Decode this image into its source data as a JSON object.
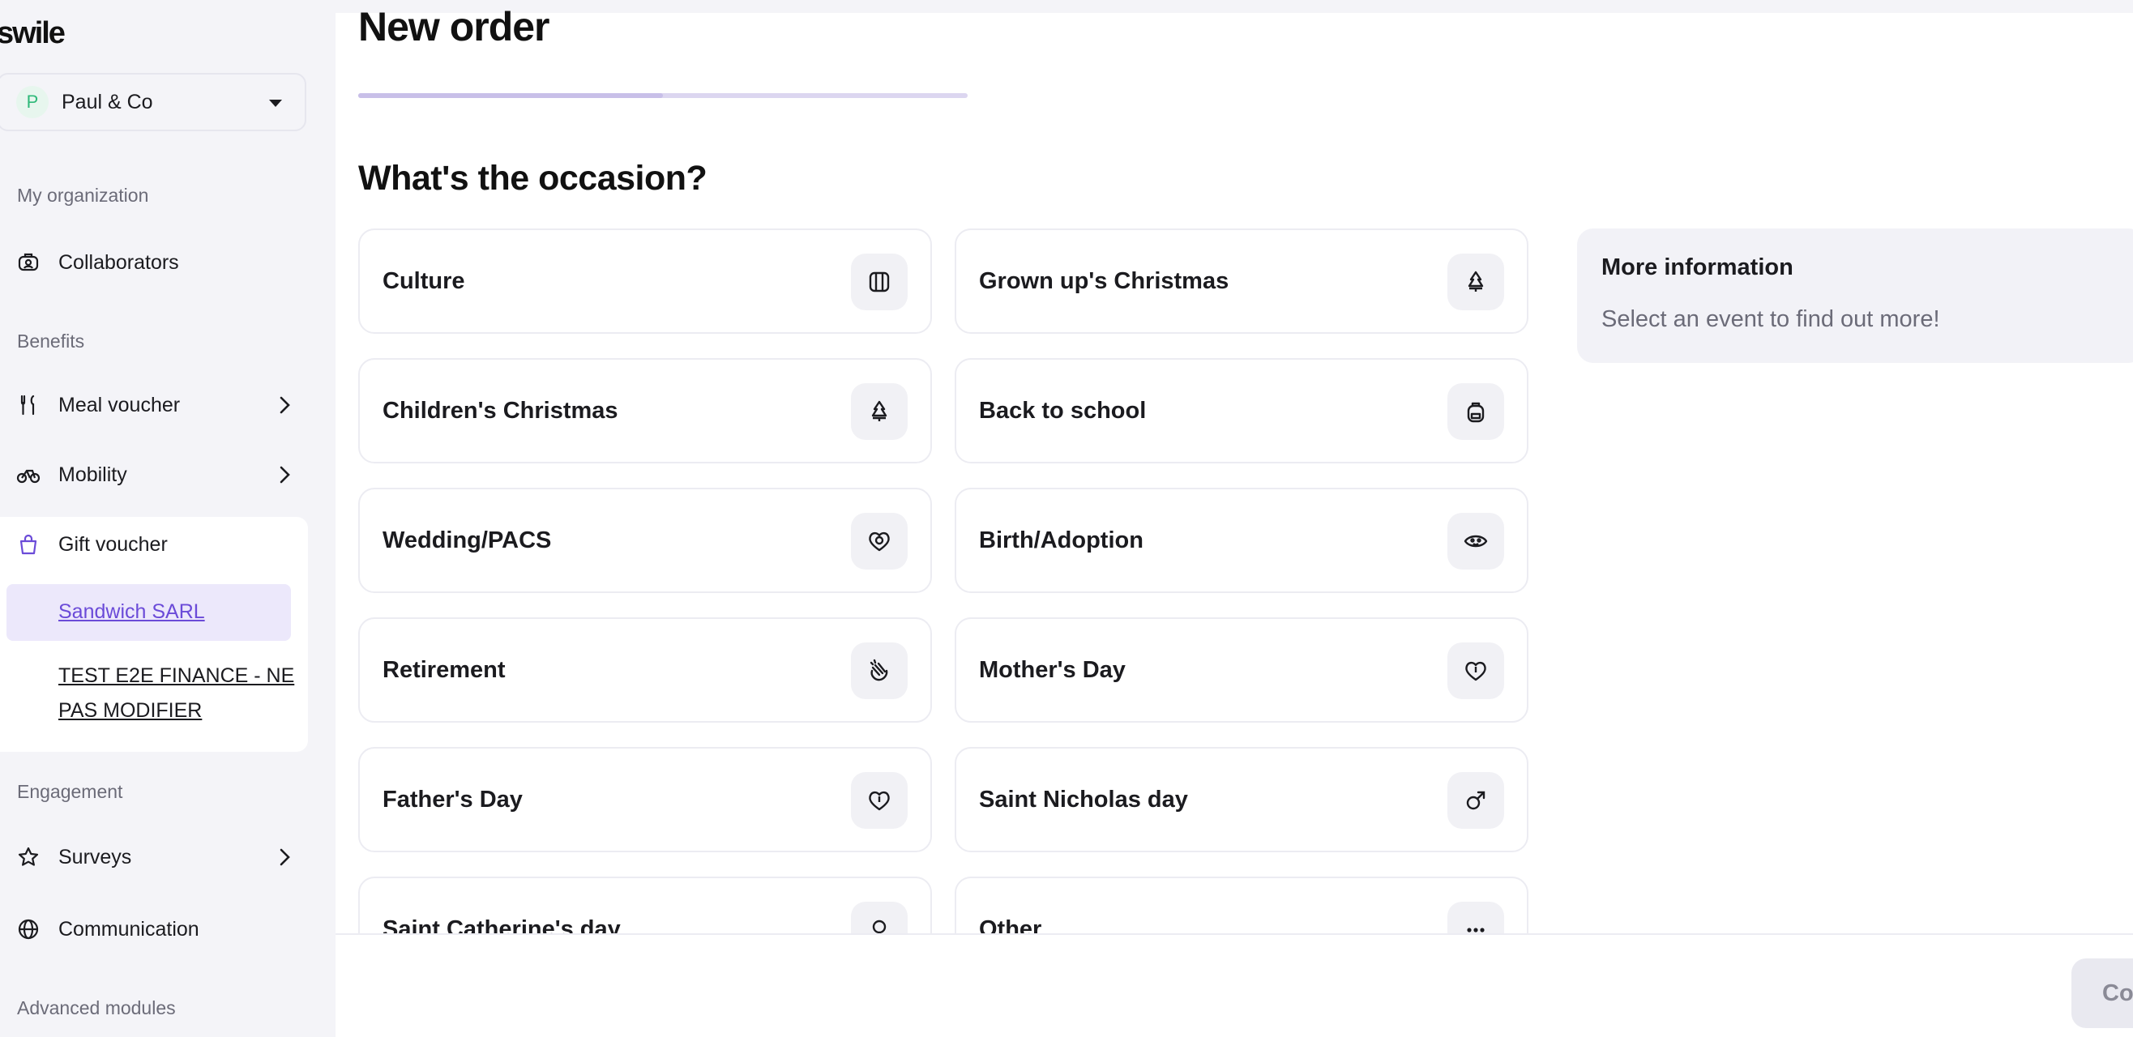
{
  "app": {
    "logo": "swile"
  },
  "org_selector": {
    "avatar_letter": "P",
    "name": "Paul & Co"
  },
  "sidebar": {
    "sections": {
      "my_organization": "My organization",
      "benefits": "Benefits",
      "engagement": "Engagement",
      "advanced": "Advanced modules"
    },
    "items": {
      "collaborators": "Collaborators",
      "meal_voucher": "Meal voucher",
      "mobility": "Mobility",
      "gift_voucher": "Gift voucher",
      "surveys": "Surveys",
      "communication": "Communication"
    },
    "gift_sub": {
      "sandwich": "Sandwich SARL",
      "test_line1": "TEST E2E FINANCE - NE",
      "test_line2": "PAS MODIFIER"
    }
  },
  "main": {
    "title": "New order",
    "progress": 0.5,
    "section_title": "What's the occasion?",
    "occasions": [
      {
        "label": "Culture",
        "icon": "book-icon"
      },
      {
        "label": "Grown up's Christmas",
        "icon": "christmas-tree-icon"
      },
      {
        "label": "Children's Christmas",
        "icon": "christmas-tree-icon"
      },
      {
        "label": "Back to school",
        "icon": "backpack-icon"
      },
      {
        "label": "Wedding/PACS",
        "icon": "heart-rings-icon"
      },
      {
        "label": "Birth/Adoption",
        "icon": "baby-face-icon"
      },
      {
        "label": "Retirement",
        "icon": "clapping-hands-icon"
      },
      {
        "label": "Mother's Day",
        "icon": "heart-icon"
      },
      {
        "label": "Father's Day",
        "icon": "heart-icon"
      },
      {
        "label": "Saint Nicholas day",
        "icon": "male-symbol-icon"
      },
      {
        "label": "Saint Catherine's day",
        "icon": "female-symbol-icon"
      },
      {
        "label": "Other",
        "icon": "more-dots-icon"
      }
    ],
    "info": {
      "title": "More information",
      "text": "Select an event to find out more!"
    },
    "footer": {
      "continue_label": "Co"
    }
  },
  "colors": {
    "accent": "#6b4bd8",
    "active_bg": "#ece8fb",
    "progress": "#c8bfe8"
  }
}
